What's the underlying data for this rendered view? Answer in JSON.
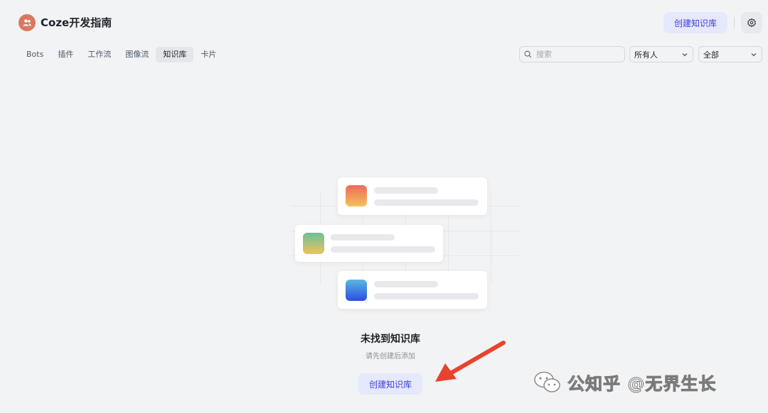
{
  "header": {
    "workspace_name": "Coze开发指南",
    "create_button_label": "创建知识库",
    "settings_icon": "gear-icon"
  },
  "tabs": [
    {
      "label": "Bots",
      "active": false
    },
    {
      "label": "插件",
      "active": false
    },
    {
      "label": "工作流",
      "active": false
    },
    {
      "label": "图像流",
      "active": false
    },
    {
      "label": "知识库",
      "active": true
    },
    {
      "label": "卡片",
      "active": false
    }
  ],
  "filters": {
    "search_placeholder": "搜索",
    "owner_value": "所有人",
    "type_value": "全部"
  },
  "empty_state": {
    "title": "未找到知识库",
    "description": "请先创建后添加",
    "button_label": "创建知识库"
  },
  "watermark": {
    "text": "公知乎 @无界生长"
  },
  "colors": {
    "accent": "#3d3ddc",
    "accent_bg": "#e6e8fb",
    "annotation_arrow": "#e8432e"
  }
}
